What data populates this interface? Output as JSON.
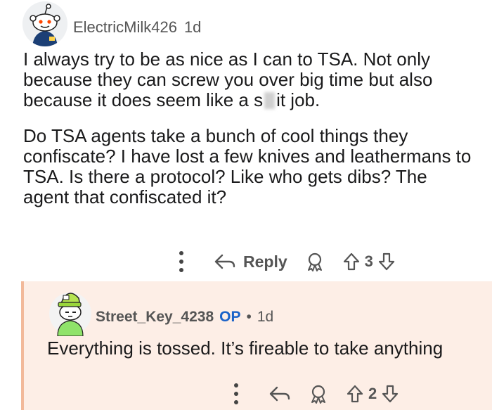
{
  "comment1": {
    "username": "ElectricMilk426",
    "time": "1d",
    "paragraph1_start": "I always try to be as nice as I can to TSA. Not only because they can screw you over big time but also because it does seem like a s",
    "paragraph1_end": "it job.",
    "paragraph2": "Do TSA agents take a bunch of cool things they confiscate? I have lost a few knives and leathermans to TSA. Is there a protocol? Like who gets dibs? The agent that confiscated it?",
    "reply_label": "Reply",
    "vote_count": "3"
  },
  "comment2": {
    "username": "Street_Key_4238",
    "op_badge": "OP",
    "separator": "•",
    "time": "1d",
    "body": "Everything is tossed. It’s fireable to take anything",
    "vote_count": "2"
  }
}
